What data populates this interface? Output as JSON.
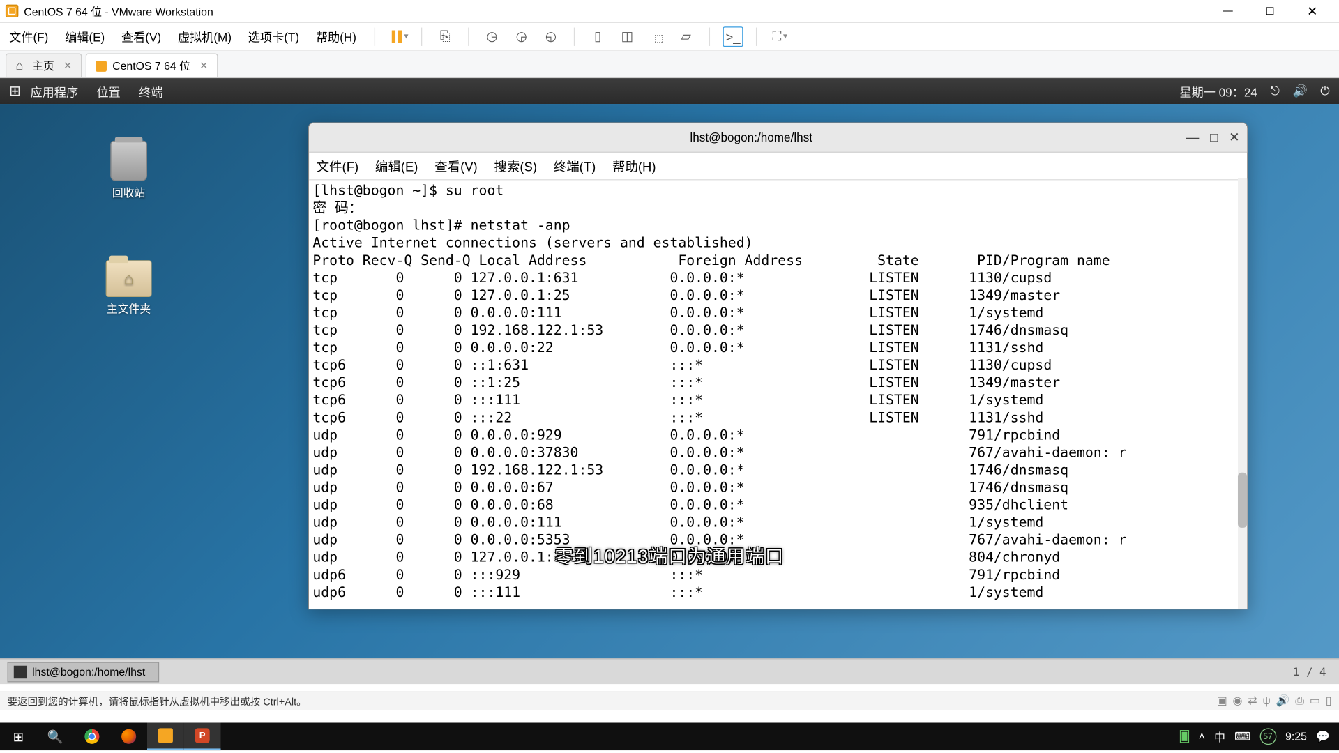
{
  "vmware": {
    "window_title": "CentOS 7 64 位 - VMware Workstation",
    "menu": {
      "file": "文件(F)",
      "edit": "编辑(E)",
      "view": "查看(V)",
      "vm": "虚拟机(M)",
      "tabs": "选项卡(T)",
      "help": "帮助(H)"
    },
    "tabs": {
      "home": "主页",
      "vm_tab": "CentOS 7 64 位"
    },
    "status_hint": "要返回到您的计算机，请将鼠标指针从虚拟机中移出或按 Ctrl+Alt。"
  },
  "gnome": {
    "apps": "应用程序",
    "places": "位置",
    "terminal_menu": "终端",
    "datetime": "星期一 09：24",
    "task_label": "lhst@bogon:/home/lhst",
    "pager": "1 / 4"
  },
  "desktop": {
    "icons": {
      "trash": "回收站",
      "home_folder": "主文件夹"
    }
  },
  "terminal": {
    "title": "lhst@bogon:/home/lhst",
    "menu": {
      "file": "文件(F)",
      "edit": "编辑(E)",
      "view": "查看(V)",
      "search": "搜索(S)",
      "term": "终端(T)",
      "help": "帮助(H)"
    },
    "lines": {
      "l1": "[lhst@bogon ~]$ su root",
      "l2": "密 码：",
      "l3": "[root@bogon lhst]# netstat -anp",
      "l4": "Active Internet connections (servers and established)",
      "hdr": "Proto Recv-Q Send-Q Local Address           Foreign Address         State       PID/Program name"
    },
    "rows": [
      {
        "p": "tcp  ",
        "r": "     0",
        "s": "      0",
        "l": "127.0.0.1:631          ",
        "f": "0.0.0.0:*              ",
        "st": "LISTEN     ",
        "pid": "1130/cupsd"
      },
      {
        "p": "tcp  ",
        "r": "     0",
        "s": "      0",
        "l": "127.0.0.1:25           ",
        "f": "0.0.0.0:*              ",
        "st": "LISTEN     ",
        "pid": "1349/master"
      },
      {
        "p": "tcp  ",
        "r": "     0",
        "s": "      0",
        "l": "0.0.0.0:111            ",
        "f": "0.0.0.0:*              ",
        "st": "LISTEN     ",
        "pid": "1/systemd"
      },
      {
        "p": "tcp  ",
        "r": "     0",
        "s": "      0",
        "l": "192.168.122.1:53       ",
        "f": "0.0.0.0:*              ",
        "st": "LISTEN     ",
        "pid": "1746/dnsmasq"
      },
      {
        "p": "tcp  ",
        "r": "     0",
        "s": "      0",
        "l": "0.0.0.0:22             ",
        "f": "0.0.0.0:*              ",
        "st": "LISTEN     ",
        "pid": "1131/sshd"
      },
      {
        "p": "tcp6 ",
        "r": "     0",
        "s": "      0",
        "l": "::1:631                ",
        "f": ":::*                   ",
        "st": "LISTEN     ",
        "pid": "1130/cupsd"
      },
      {
        "p": "tcp6 ",
        "r": "     0",
        "s": "      0",
        "l": "::1:25                 ",
        "f": ":::*                   ",
        "st": "LISTEN     ",
        "pid": "1349/master"
      },
      {
        "p": "tcp6 ",
        "r": "     0",
        "s": "      0",
        "l": ":::111                 ",
        "f": ":::*                   ",
        "st": "LISTEN     ",
        "pid": "1/systemd"
      },
      {
        "p": "tcp6 ",
        "r": "     0",
        "s": "      0",
        "l": ":::22                  ",
        "f": ":::*                   ",
        "st": "LISTEN     ",
        "pid": "1131/sshd"
      },
      {
        "p": "udp  ",
        "r": "     0",
        "s": "      0",
        "l": "0.0.0.0:929            ",
        "f": "0.0.0.0:*              ",
        "st": "           ",
        "pid": "791/rpcbind"
      },
      {
        "p": "udp  ",
        "r": "     0",
        "s": "      0",
        "l": "0.0.0.0:37830          ",
        "f": "0.0.0.0:*              ",
        "st": "           ",
        "pid": "767/avahi-daemon: r"
      },
      {
        "p": "udp  ",
        "r": "     0",
        "s": "      0",
        "l": "192.168.122.1:53       ",
        "f": "0.0.0.0:*              ",
        "st": "           ",
        "pid": "1746/dnsmasq"
      },
      {
        "p": "udp  ",
        "r": "     0",
        "s": "      0",
        "l": "0.0.0.0:67             ",
        "f": "0.0.0.0:*              ",
        "st": "           ",
        "pid": "1746/dnsmasq"
      },
      {
        "p": "udp  ",
        "r": "     0",
        "s": "      0",
        "l": "0.0.0.0:68             ",
        "f": "0.0.0.0:*              ",
        "st": "           ",
        "pid": "935/dhclient"
      },
      {
        "p": "udp  ",
        "r": "     0",
        "s": "      0",
        "l": "0.0.0.0:111            ",
        "f": "0.0.0.0:*              ",
        "st": "           ",
        "pid": "1/systemd"
      },
      {
        "p": "udp  ",
        "r": "     0",
        "s": "      0",
        "l": "0.0.0.0:5353           ",
        "f": "0.0.0.0:*              ",
        "st": "           ",
        "pid": "767/avahi-daemon: r"
      },
      {
        "p": "udp  ",
        "r": "     0",
        "s": "      0",
        "l": "127.0.0.1:323          ",
        "f": "0.0.0.0:*              ",
        "st": "           ",
        "pid": "804/chronyd"
      },
      {
        "p": "udp6 ",
        "r": "     0",
        "s": "      0",
        "l": ":::929                 ",
        "f": ":::*                   ",
        "st": "           ",
        "pid": "791/rpcbind"
      },
      {
        "p": "udp6 ",
        "r": "     0",
        "s": "      0",
        "l": ":::111                 ",
        "f": ":::*                   ",
        "st": "           ",
        "pid": "1/systemd"
      }
    ]
  },
  "subtitle": "零到10213端口为通用端口",
  "windows_taskbar": {
    "clock": "9:25",
    "ime_lang": "中",
    "ime_num": "57"
  }
}
